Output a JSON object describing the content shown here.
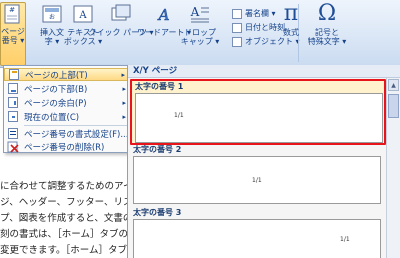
{
  "ribbon": {
    "page_number_label": [
      "ページ",
      "番号 ▾"
    ],
    "textbox_label": [
      "テキスト",
      "ボックス ▾"
    ],
    "header_footer_label": [
      "挿入文",
      "字 ▾"
    ],
    "quickparts_label": "クイック パーツ ▾",
    "wordart_label": "ワードアート ▾",
    "dropcap_label": [
      "ドロップ",
      "キャップ ▾"
    ],
    "signature_label": "署名欄 ▾",
    "datetime_label": "日付と時刻",
    "object_label": "オブジェクト ▾",
    "equation_label": "数式",
    "symbol_label": [
      "記号と",
      "特殊文字 ▾"
    ],
    "equation_glyph": "π",
    "symbol_glyph": "Ω"
  },
  "menu": {
    "items": [
      {
        "label": "ページの上部(T)",
        "icon": "page-top-icon",
        "has_submenu": true,
        "selected": true
      },
      {
        "label": "ページの下部(B)",
        "icon": "page-bottom-icon",
        "has_submenu": true
      },
      {
        "label": "ページの余白(P)",
        "icon": "page-margin-icon",
        "has_submenu": true
      },
      {
        "label": "現在の位置(C)",
        "icon": "current-position-icon",
        "has_submenu": true
      },
      {
        "label": "ページ番号の書式設定(F)...",
        "icon": "format-icon",
        "has_submenu": false
      },
      {
        "label": "ページ番号の削除(R)",
        "icon": "delete-page-number-icon",
        "has_submenu": false
      }
    ],
    "arrow": "▸"
  },
  "gallery": {
    "header": "X/Y ページ",
    "items": [
      {
        "label": "太字の番号 1",
        "preview": "1/1",
        "selected": true
      },
      {
        "label": "太字の番号 2",
        "preview": "1/1",
        "selected": false
      },
      {
        "label": "太字の番号 3",
        "preview": "1/1",
        "selected": false
      }
    ]
  },
  "document": {
    "lines": [
      "に合わせて調整するためのアイ",
      "ジ、ヘッダー、フッター、リスト",
      "プ、図表を作成すると、文書の",
      "刻の書式は、［ホーム］タブのク",
      "変更できます。［ホーム］タブの"
    ]
  }
}
